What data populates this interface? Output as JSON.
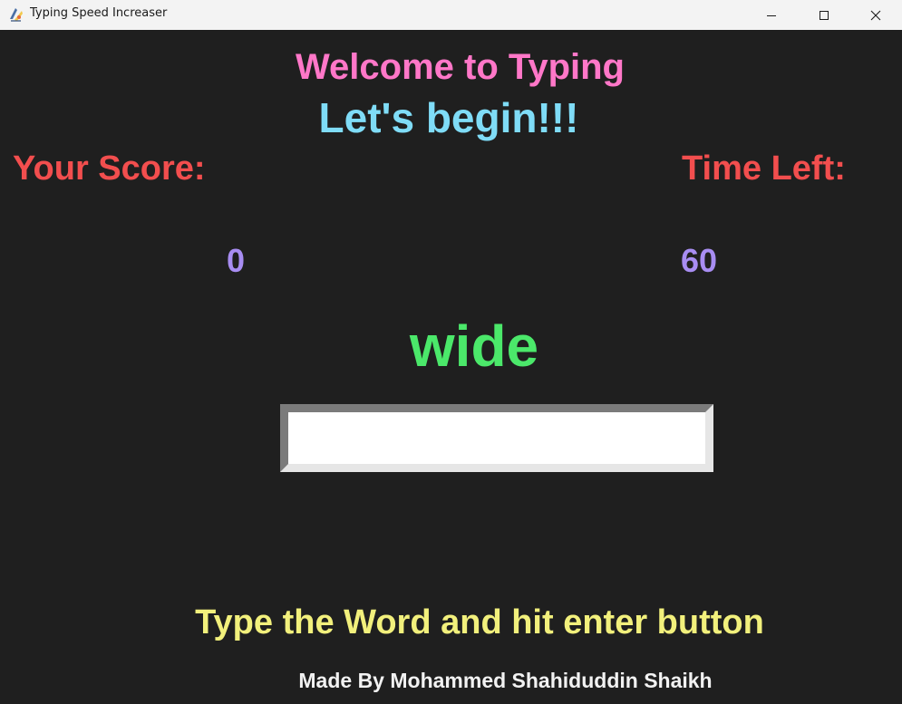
{
  "window": {
    "title": "Typing Speed Increaser",
    "app_icon": "python-feather-icon",
    "controls": [
      "minimize-icon",
      "maximize-icon",
      "close-icon"
    ]
  },
  "game": {
    "welcome": "Welcome to Typing",
    "begin": "Let's begin!!!",
    "score_label": "Your Score:",
    "time_label": "Time Left:",
    "score_value": "0",
    "time_value": "60",
    "current_word": "wide",
    "entry_value": "",
    "instruction": "Type the Word and hit enter button",
    "credit": "Made By Mohammed Shahiduddin Shaikh"
  },
  "colors": {
    "background": "#1f1f1f",
    "welcome": "#ff77c8",
    "begin": "#7fdcf7",
    "labels": "#f24e4e",
    "values": "#a88df2",
    "word": "#4be86a",
    "instruction": "#f2f07c",
    "credit": "#f2f2f2"
  }
}
